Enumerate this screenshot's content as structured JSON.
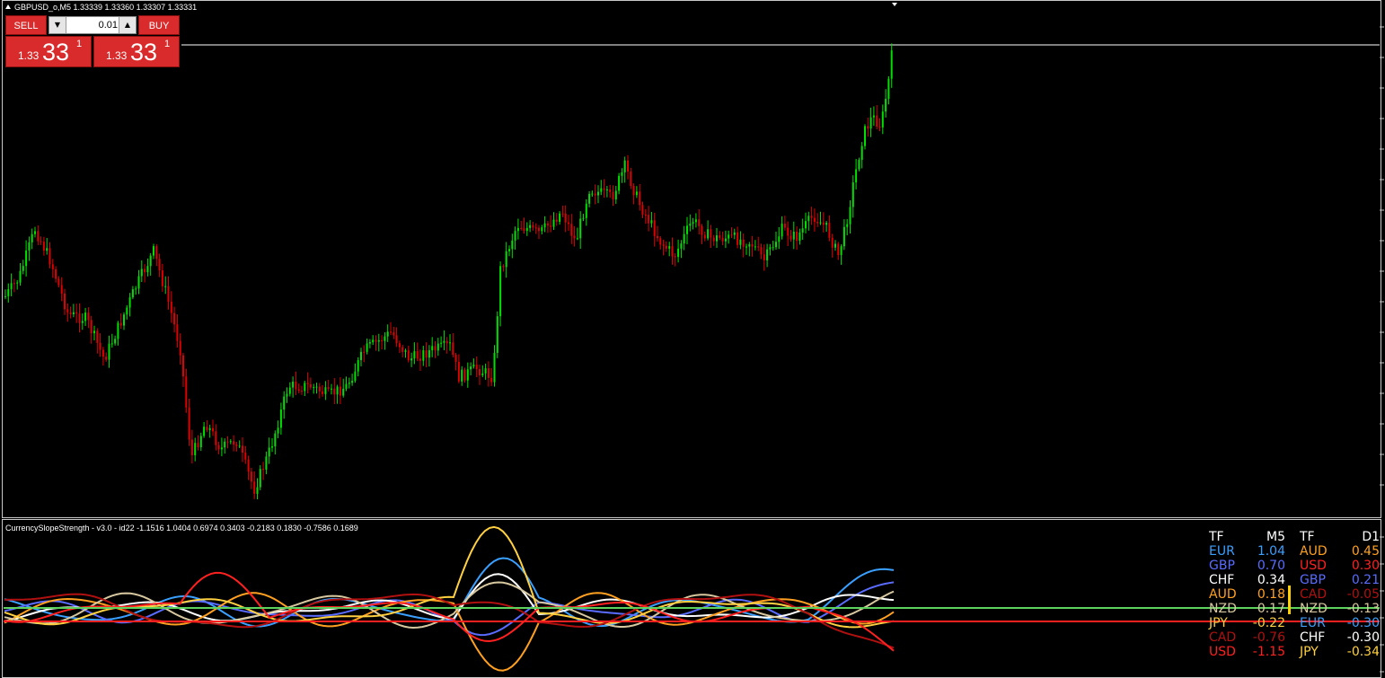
{
  "chart": {
    "title": "GBPUSD_o,M5  1.33339 1.33360 1.33307 1.33331",
    "bid_line_color": "#ffffff",
    "bull_color": "#00e000",
    "bear_color": "#e00000"
  },
  "trade_panel": {
    "sell_label": "SELL",
    "buy_label": "BUY",
    "lot_value": "0.01",
    "down_icon": "triangle-down",
    "up_icon": "triangle-up",
    "sell_price": {
      "prefix": "1.33",
      "big": "33",
      "sup": "1"
    },
    "buy_price": {
      "prefix": "1.33",
      "big": "33",
      "sup": "1"
    }
  },
  "indicator": {
    "title": "CurrencySlopeStrength - v3.0 - id22 -1.1516 1.0404 0.6974 0.3403 -0.2183 0.1830 -0.7586 0.1689",
    "level_green_color": "#5dd35d",
    "level_red_color": "#ff2020",
    "level_marker_color": "#ffd000"
  },
  "strength_table": {
    "header": {
      "tf_left": "TF",
      "tf_left_val": "M5",
      "tf_right": "TF",
      "tf_right_val": "D1"
    },
    "rows": [
      {
        "c1": "EUR",
        "v1": "1.04",
        "col1": "#3aa0ff",
        "c2": "AUD",
        "v2": "0.45",
        "col2": "#ffa020"
      },
      {
        "c1": "GBP",
        "v1": "0.70",
        "col1": "#5a6cff",
        "c2": "USD",
        "v2": "0.30",
        "col2": "#ff2020"
      },
      {
        "c1": "CHF",
        "v1": "0.34",
        "col1": "#ffffff",
        "c2": "GBP",
        "v2": "0.21",
        "col2": "#5a6cff"
      },
      {
        "c1": "AUD",
        "v1": "0.18",
        "col1": "#ffa020",
        "c2": "CAD",
        "v2": "-0.05",
        "col2": "#b01010"
      },
      {
        "c1": "NZD",
        "v1": "0.17",
        "col1": "#d8c8a0",
        "c2": "NZD",
        "v2": "-0.13",
        "col2": "#d8c8a0"
      },
      {
        "c1": "JPY",
        "v1": "-0.22",
        "col1": "#ffd040",
        "c2": "EUR",
        "v2": "-0.30",
        "col2": "#3aa0ff"
      },
      {
        "c1": "CAD",
        "v1": "-0.76",
        "col1": "#b01010",
        "c2": "CHF",
        "v2": "-0.30",
        "col2": "#ffffff"
      },
      {
        "c1": "USD",
        "v1": "-1.15",
        "col1": "#ff2020",
        "c2": "JPY",
        "v2": "-0.34",
        "col2": "#ffd040"
      }
    ]
  }
}
